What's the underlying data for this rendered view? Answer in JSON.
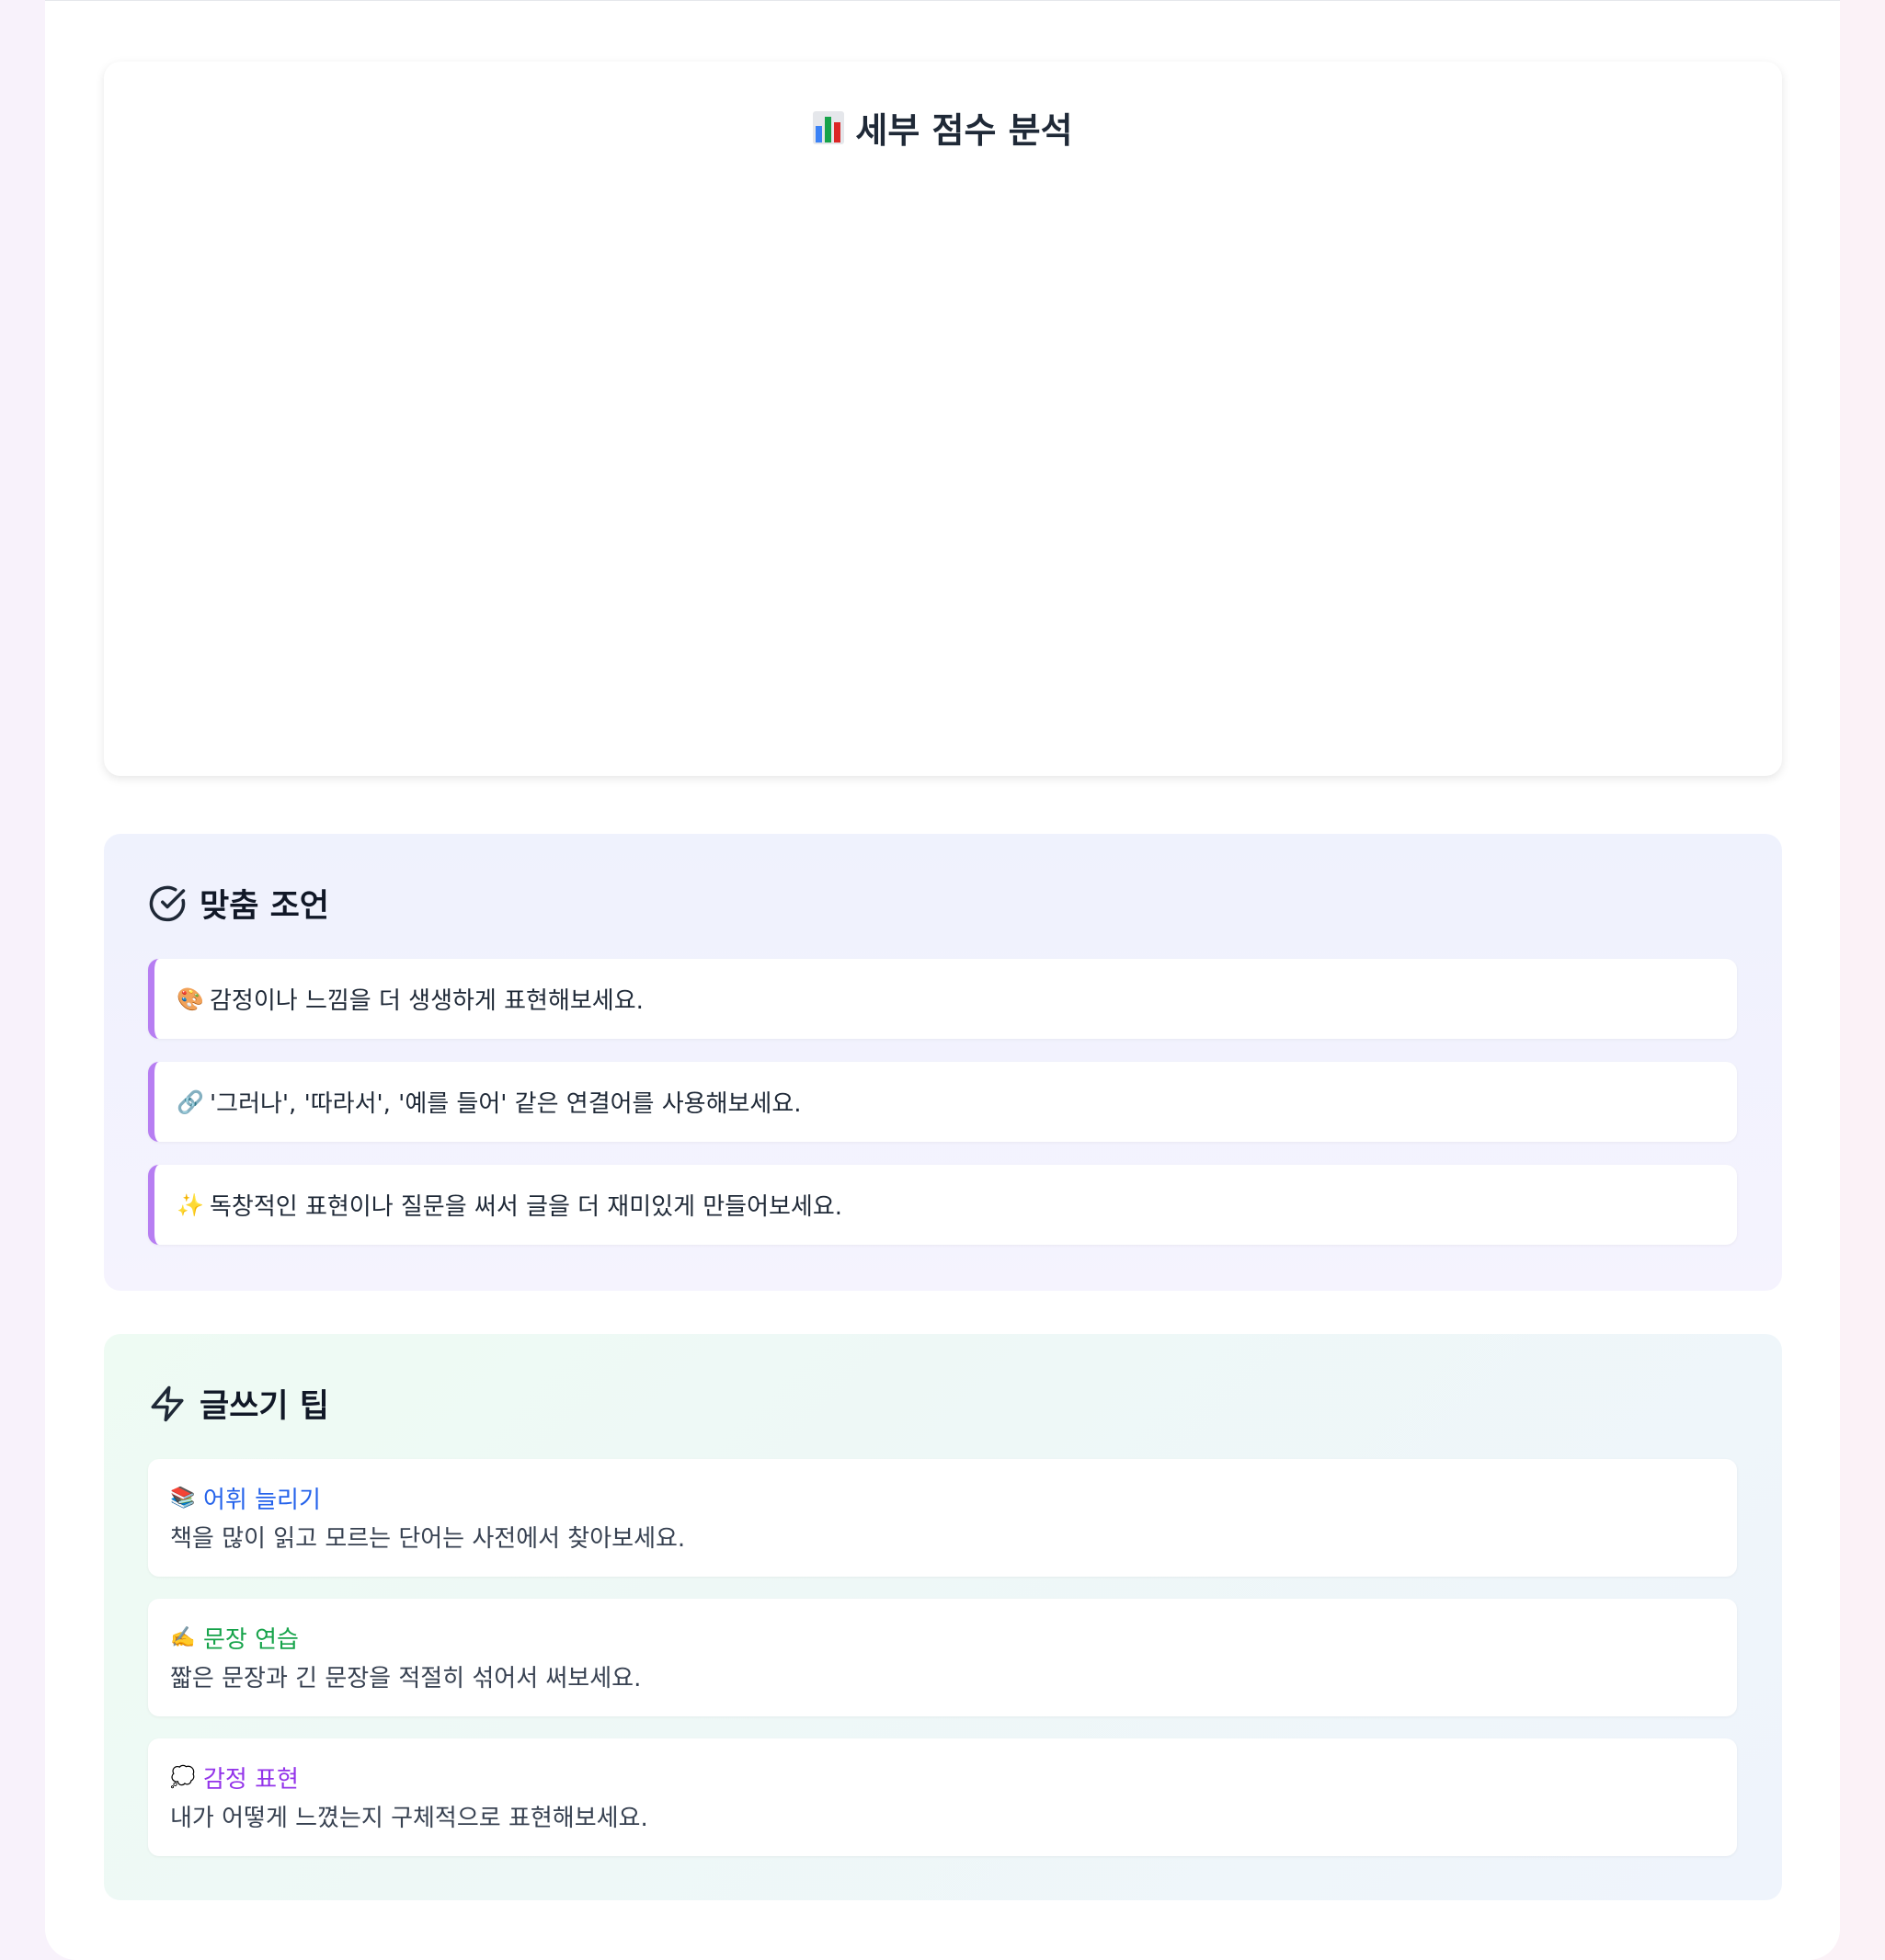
{
  "chart_card": {
    "title": "세부 점수 분석"
  },
  "advice": {
    "heading": "맞춤 조언",
    "items": [
      {
        "emoji": "🎨",
        "text": "감정이나 느낌을 더 생생하게 표현해보세요."
      },
      {
        "emoji": "🔗",
        "text": "'그러나', '따라서', '예를 들어' 같은 연결어를 사용해보세요."
      },
      {
        "emoji": "✨",
        "text": "독창적인 표현이나 질문을 써서 글을 더 재미있게 만들어보세요."
      }
    ]
  },
  "tips": {
    "heading": "글쓰기 팁",
    "items": [
      {
        "emoji": "📚",
        "title": "어휘 늘리기",
        "desc": "책을 많이 읽고 모르는 단어는 사전에서 찾아보세요.",
        "color": "#2563eb"
      },
      {
        "emoji": "✍️",
        "title": "문장 연습",
        "desc": "짧은 문장과 긴 문장을 적절히 섞어서 써보세요.",
        "color": "#16a34a"
      },
      {
        "emoji": "💭",
        "title": "감정 표현",
        "desc": "내가 어떻게 느꼈는지 구체적으로 표현해보세요.",
        "color": "#9333ea"
      }
    ]
  },
  "colors": {
    "advice_accent": "#b77ef2",
    "text": "#1f2937"
  }
}
